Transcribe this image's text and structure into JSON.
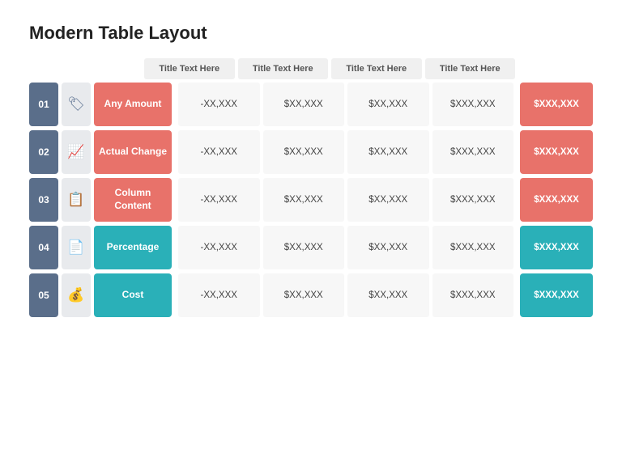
{
  "title": "Modern Table Layout",
  "header": {
    "cols": [
      "Title Text Here",
      "Title Text Here",
      "Title Text Here",
      "Title Text Here"
    ]
  },
  "rows": [
    {
      "number": "01",
      "icon": "🏷",
      "label": "Any Amount",
      "type": "salmon",
      "cells": [
        "-XX,XXX",
        "$XX,XXX",
        "$XX,XXX",
        "$XXX,XXX"
      ],
      "summary": "$XXX,XXX"
    },
    {
      "number": "02",
      "icon": "📈",
      "label": "Actual Change",
      "type": "salmon",
      "cells": [
        "-XX,XXX",
        "$XX,XXX",
        "$XX,XXX",
        "$XXX,XXX"
      ],
      "summary": "$XXX,XXX"
    },
    {
      "number": "03",
      "icon": "📋",
      "label": "Column Content",
      "type": "salmon",
      "cells": [
        "-XX,XXX",
        "$XX,XXX",
        "$XX,XXX",
        "$XXX,XXX"
      ],
      "summary": "$XXX,XXX"
    },
    {
      "number": "04",
      "icon": "📄",
      "label": "Percentage",
      "type": "teal",
      "cells": [
        "-XX,XXX",
        "$XX,XXX",
        "$XX,XXX",
        "$XXX,XXX"
      ],
      "summary": "$XXX,XXX"
    },
    {
      "number": "05",
      "icon": "💰",
      "label": "Cost",
      "type": "teal",
      "cells": [
        "-XX,XXX",
        "$XX,XXX",
        "$XX,XXX",
        "$XXX,XXX"
      ],
      "summary": "$XXX,XXX"
    }
  ]
}
